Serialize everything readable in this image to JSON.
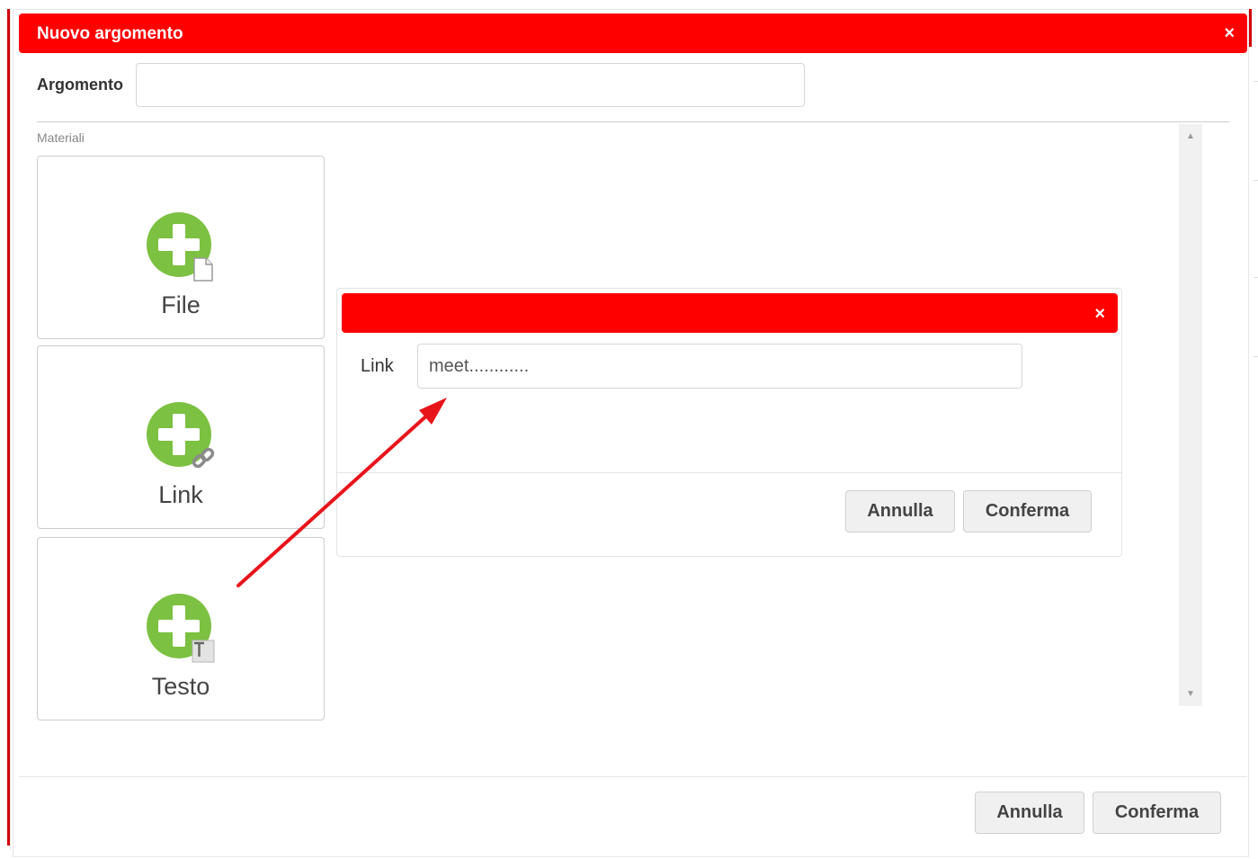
{
  "modal": {
    "title": "Nuovo argomento",
    "close_symbol": "×",
    "argomento_label": "Argomento",
    "argomento_value": "",
    "materials_label": "Materiali",
    "cards": [
      {
        "label": "File",
        "icon": "plus-file-icon"
      },
      {
        "label": "Link",
        "icon": "plus-link-icon"
      },
      {
        "label": "Testo",
        "icon": "plus-text-icon"
      }
    ],
    "cancel_label": "Annulla",
    "confirm_label": "Conferma"
  },
  "link_dialog": {
    "close_symbol": "×",
    "link_label": "Link",
    "link_value": "meet............",
    "cancel_label": "Annulla",
    "confirm_label": "Conferma"
  },
  "colors": {
    "header": "#ff0000",
    "plus_icon": "#7cc142",
    "annotation_arrow": "#e8141b"
  }
}
